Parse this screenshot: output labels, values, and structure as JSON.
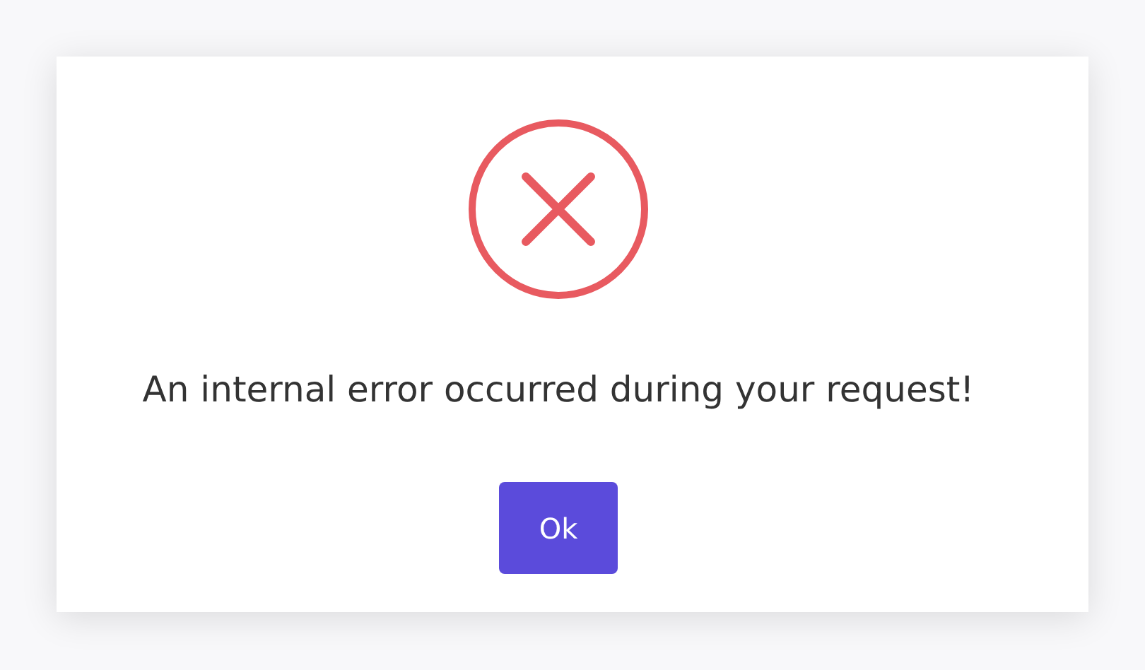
{
  "dialog": {
    "message": "An internal error occurred during your request!",
    "button": "Ok"
  }
}
